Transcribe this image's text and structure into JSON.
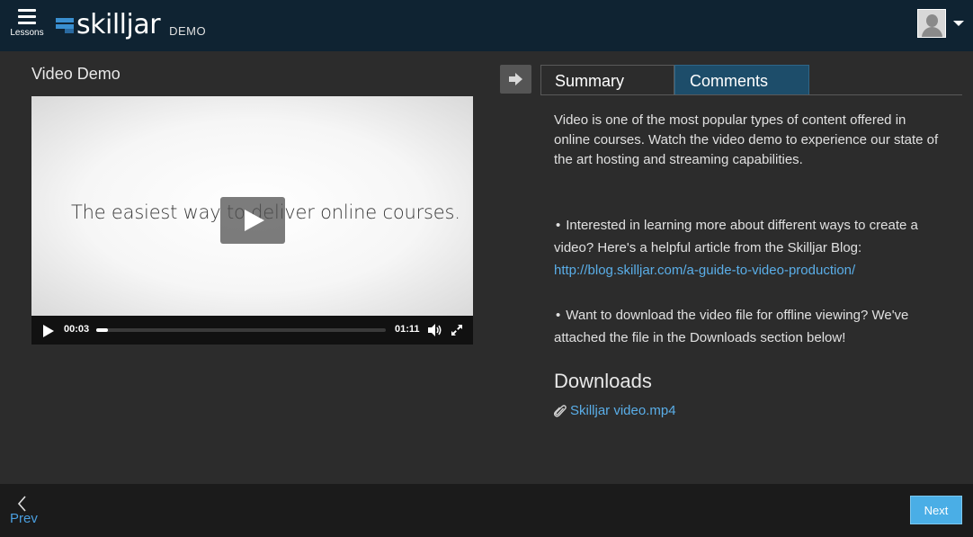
{
  "header": {
    "lessons_label": "Lessons",
    "brand": "skilljar",
    "brand_suffix": "DEMO"
  },
  "lesson": {
    "title": "Video Demo"
  },
  "video": {
    "caption": "The easiest way to deliver online courses.",
    "current_time": "00:03",
    "duration": "01:11",
    "progress_fraction": 0.04
  },
  "tabs": [
    {
      "label": "Summary",
      "active": true
    },
    {
      "label": "Comments",
      "active": false
    }
  ],
  "summary": {
    "intro": "Video is one of the most popular types of content offered in online courses. Watch the video demo to experience our state of the art hosting and streaming capabilities.",
    "bullet1_text": "Interested in learning more about different ways to create a video? Here's a helpful article from the Skilljar Blog: ",
    "bullet1_link": "http://blog.skilljar.com/a-guide-to-video-production/",
    "bullet2_text": "Want to download the video file for offline viewing? We've attached the file in the Downloads section below!"
  },
  "downloads": {
    "heading": "Downloads",
    "file_name": "Skilljar video.mp4"
  },
  "footer": {
    "prev_label": "Prev",
    "next_label": "Next"
  },
  "colors": {
    "topbar": "#0f2332",
    "background": "#2c2c2c",
    "accent": "#4aaee6",
    "comments_tab": "#1d4d6a"
  }
}
